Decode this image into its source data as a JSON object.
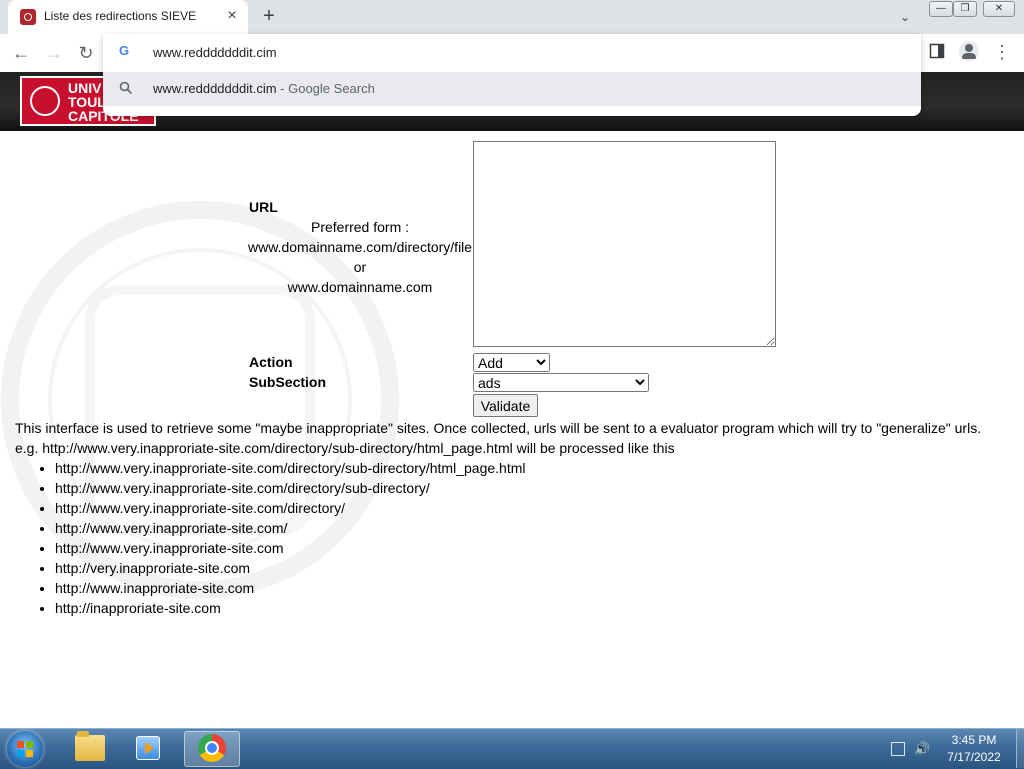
{
  "browser": {
    "tab_title": "Liste des redirections SIEVE",
    "tab_close_glyph": "×",
    "new_tab_glyph": "+",
    "omnibox_value": "www.redddddddit.cim",
    "suggestion": {
      "text": "www.redddddddit.cim",
      "suffix": " - Google Search"
    }
  },
  "header": {
    "logo_text": "UNIV\nTOUL\nCAPITOLE"
  },
  "form": {
    "url_label": "URL",
    "hint_line1": "Preferred form :",
    "hint_line2": "www.domainname.com/directory/file",
    "hint_line3": "or",
    "hint_line4": "www.domainname.com",
    "url_value": "",
    "action_label": "Action",
    "action_selected": "Add",
    "subsection_label": "SubSection",
    "subsection_selected": "ads",
    "validate_label": "Validate"
  },
  "description": {
    "line1": "This interface is used to retrieve some \"maybe inappropriate\" sites. Once collected, urls will be sent to a evaluator program which will try to \"generalize\" urls.",
    "line2": "e.g. http://www.very.inapproriate-site.com/directory/sub-directory/html_page.html will be processed like this",
    "examples": [
      "http://www.very.inapproriate-site.com/directory/sub-directory/html_page.html",
      "http://www.very.inapproriate-site.com/directory/sub-directory/",
      "http://www.very.inapproriate-site.com/directory/",
      "http://www.very.inapproriate-site.com/",
      "http://www.very.inapproriate-site.com",
      "http://very.inapproriate-site.com",
      "http://www.inapproriate-site.com",
      "http://inapproriate-site.com"
    ]
  },
  "taskbar": {
    "time": "3:45 PM",
    "date": "7/17/2022"
  },
  "colors": {
    "header_bg": "#2a2a2a",
    "logo_red": "#c8102e",
    "taskbar_blue": "#3d6a98"
  }
}
